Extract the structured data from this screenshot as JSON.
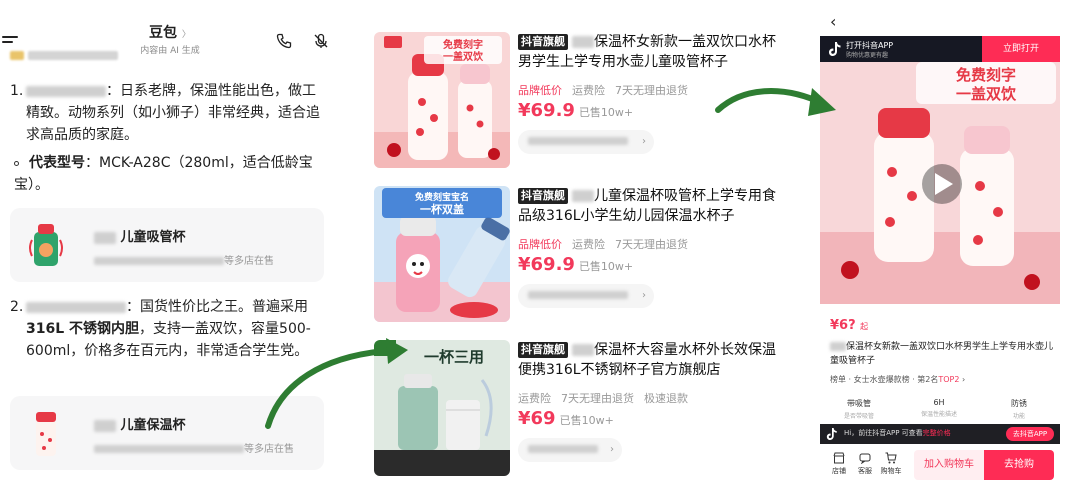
{
  "chat": {
    "title": "豆包",
    "title_chevron": "〉",
    "subtitle": "内容由 AI 生成",
    "item1": {
      "number": "1.",
      "text": "：日系老牌，保温性能出色，做工精致。动物系列（如小狮子）非常经典，适合追求高品质的家庭。",
      "model_label": "代表型号",
      "model_text": "：MCK-A28C（280ml，适合低龄宝宝）。"
    },
    "card1": {
      "title": "儿童吸管杯",
      "sub": "等多店在售"
    },
    "item2": {
      "number": "2.",
      "text_a": "：国货性价比之王。普遍采用",
      "bold": "316L 不锈钢内胆",
      "text_b": "，支持一盖双饮，容量500-600ml，价格多在百元内，非常适合学生党。"
    },
    "card2": {
      "title": "儿童保温杯",
      "sub": "等多店在售"
    }
  },
  "products": [
    {
      "tag": "抖音旗舰",
      "name": "保温杯女新款一盖双饮口水杯男学生上学专用水壶儿童吸管杯子",
      "meta": [
        "品牌低价",
        "运费险",
        "7天无理由退货"
      ],
      "price": "¥69.9",
      "sold": "已售10w+",
      "img_text": [
        "免费刻字",
        "一盖双饮"
      ]
    },
    {
      "tag": "抖音旗舰",
      "name": "儿童保温杯吸管杯上学专用食品级316L小学生幼儿园保温水杯子",
      "meta": [
        "品牌低价",
        "运费险",
        "7天无理由退货"
      ],
      "price": "¥69.9",
      "sold": "已售10w+",
      "img_text": [
        "免费刻宝宝名",
        "一杯双盖"
      ]
    },
    {
      "tag": "抖音旗舰",
      "name": "保温杯大容量水杯外长效保温便携316L不锈钢杯子官方旗舰店",
      "meta": [
        "运费险",
        "7天无理由退货",
        "极速退款"
      ],
      "price": "¥69",
      "sold": "已售10w+",
      "img_text": [
        "一杯三用"
      ]
    }
  ],
  "detail": {
    "back": "‹",
    "app_title": "打开抖音APP",
    "app_sub": "购物优惠更有趣",
    "open_btn": "立即打开",
    "hero_text": [
      "免费刻字",
      "一盖双饮"
    ],
    "price": "¥6?",
    "price_suffix": "起",
    "name": "保温杯女新款一盖双饮口水杯男学生上学专用水壶儿童吸管杯子",
    "rank_a": "榜单 · 女士水壶爆款榜 · 第2名",
    "rank_b": "TOP2",
    "features": [
      {
        "label": "带吸管",
        "sub": "是否带吸管"
      },
      {
        "label": "6H",
        "sub": "保温性能描述"
      },
      {
        "label": "防锈",
        "sub": "功能"
      }
    ],
    "notice_a": "Hi，前往抖音APP 可查看",
    "notice_b": "完整价格",
    "notice_btn": "去抖音APP",
    "bottom_icons": [
      "店铺",
      "客服",
      "购物车"
    ],
    "cart_btn": "加入购物车",
    "buy_btn": "去抢购"
  },
  "colors": {
    "accent": "#fe2c55",
    "price": "#f2395b",
    "arrow": "#2e7d32"
  }
}
